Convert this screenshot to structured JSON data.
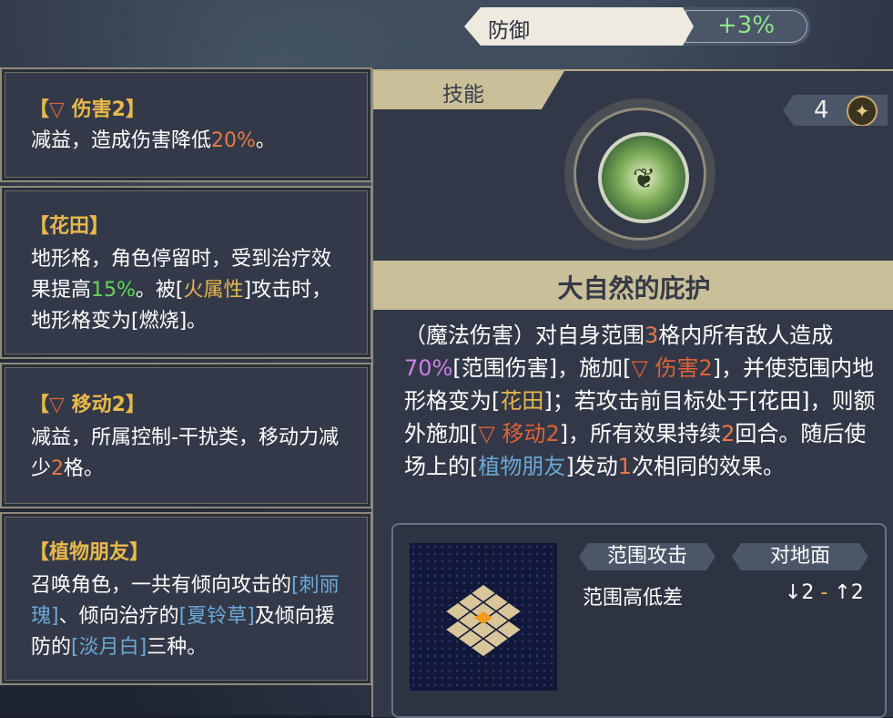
{
  "stat": {
    "name": "防御",
    "value": "+3%"
  },
  "cards": [
    {
      "title_pre": "【",
      "title_icon": "▽",
      "title": " 伤害2】",
      "lines": [
        "减益，造成伤害降低",
        "20%",
        "。"
      ]
    },
    {
      "title": "【花田】",
      "text_a": "地形格，角色停留时，受到治疗效果提高",
      "pct": "15%",
      "text_b": "。被[",
      "fire": "火属性",
      "text_c": "]攻击时，地形格变为[燃烧]。"
    },
    {
      "title_pre": "【",
      "title_icon": "▽",
      "title": " 移动2】",
      "text_a": "减益，所属控制-干扰类，移动力减少",
      "num": "2",
      "text_b": "格。"
    },
    {
      "title": "【植物朋友】",
      "text_a": "召唤角色，一共有倾向攻击的",
      "p1": "[刺丽瑰]",
      "text_b": "、倾向治疗的",
      "p2": "[夏铃草]",
      "text_c": "及倾向援防的",
      "p3": "[淡月白]",
      "text_d": "三种。"
    }
  ],
  "skill": {
    "tab": "技能",
    "cost": "4",
    "cost_icon": "star-icon",
    "name": "大自然的庇护",
    "desc": {
      "a": "（魔法伤害）对自身范围",
      "n1": "3",
      "b": "格内所有敌人造成",
      "p70": "70%",
      "c": "[范围伤害]，施加[",
      "t1": "▽ 伤害2",
      "d": "]，并使范围内地形格变为[",
      "hua": "花田",
      "e": "]；若攻击前目标处于[花田]，则额外施加[",
      "t2": "▽ 移动2",
      "f": "]，所有效果持续",
      "n2": "2",
      "g": "回合。随后使场上的[",
      "plant": "植物朋友",
      "h": "]发动",
      "n3": "1",
      "i": "次相同的效果。"
    },
    "tags": [
      "范围攻击",
      "对地面"
    ],
    "range_label": "范围高低差",
    "range_low": "↓2",
    "range_sep": " - ",
    "range_high": "↑2"
  }
}
